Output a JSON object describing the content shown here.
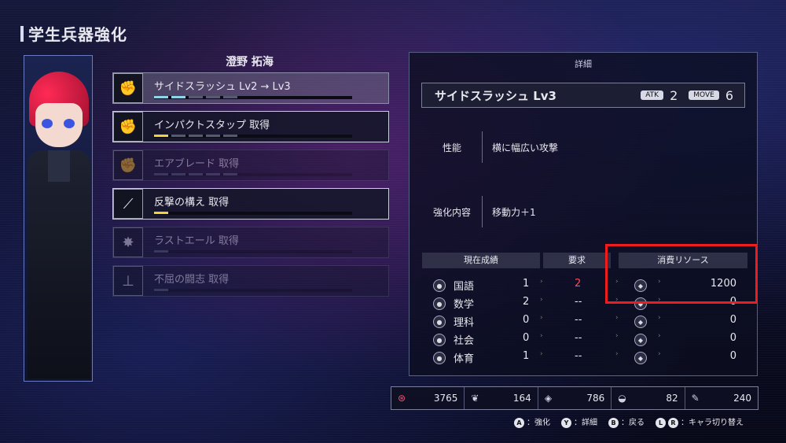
{
  "header": {
    "title": "学生兵器強化"
  },
  "character": {
    "name": "澄野 拓海"
  },
  "skills": [
    {
      "label": "サイドスラッシュ Lv2 → Lv3",
      "icon": "fist-icon",
      "state": "selected",
      "pips": [
        "c",
        "c",
        "g",
        "g",
        "g"
      ]
    },
    {
      "label": "インパクトスタップ 取得",
      "icon": "fist-icon",
      "state": "on",
      "pips": [
        "y",
        "g",
        "g",
        "g",
        "g"
      ]
    },
    {
      "label": "エアブレード 取得",
      "icon": "fist-icon",
      "state": "dim",
      "pips": [
        "g",
        "g",
        "g",
        "g",
        "g"
      ]
    },
    {
      "label": "反撃の構え 取得",
      "icon": "blade-icon",
      "state": "on",
      "pips": [
        "y"
      ]
    },
    {
      "label": "ラストエール 取得",
      "icon": "burst-icon",
      "state": "dim",
      "pips": [
        "g"
      ]
    },
    {
      "label": "不屈の闘志 取得",
      "icon": "tower-icon",
      "state": "dim",
      "pips": [
        "g"
      ]
    }
  ],
  "detail": {
    "header": "詳細",
    "skill_name": "サイドスラッシュ Lv3",
    "atk_tag": "ATK",
    "atk_value": "2",
    "move_tag": "MOVE",
    "move_value": "6",
    "perf_label": "性能",
    "perf_value": "横に幅広い攻撃",
    "enh_label": "強化内容",
    "enh_value": "移動力＋1"
  },
  "table": {
    "col_grades": "現在成績",
    "col_req": "要求",
    "col_resource": "消費リソース",
    "rows": [
      {
        "subject": "国語",
        "current": "1",
        "required": "2",
        "resource": "1200"
      },
      {
        "subject": "数学",
        "current": "2",
        "required": "--",
        "resource": "0"
      },
      {
        "subject": "理科",
        "current": "0",
        "required": "--",
        "resource": "0"
      },
      {
        "subject": "社会",
        "current": "0",
        "required": "--",
        "resource": "0"
      },
      {
        "subject": "体育",
        "current": "1",
        "required": "--",
        "resource": "0"
      }
    ]
  },
  "resources": [
    {
      "icon": "gear-resource-icon",
      "value": "3765"
    },
    {
      "icon": "leaf-resource-icon",
      "value": "164"
    },
    {
      "icon": "crystal-resource-icon",
      "value": "786"
    },
    {
      "icon": "bowl-resource-icon",
      "value": "82"
    },
    {
      "icon": "wrench-resource-icon",
      "value": "240"
    }
  ],
  "hints": [
    {
      "btn": "A",
      "label": "：強化"
    },
    {
      "btn": "Y",
      "label": "：詳細"
    },
    {
      "btn": "B",
      "label": "：戻る"
    },
    {
      "btn": "L R",
      "label": "：キャラ切り替え"
    }
  ]
}
